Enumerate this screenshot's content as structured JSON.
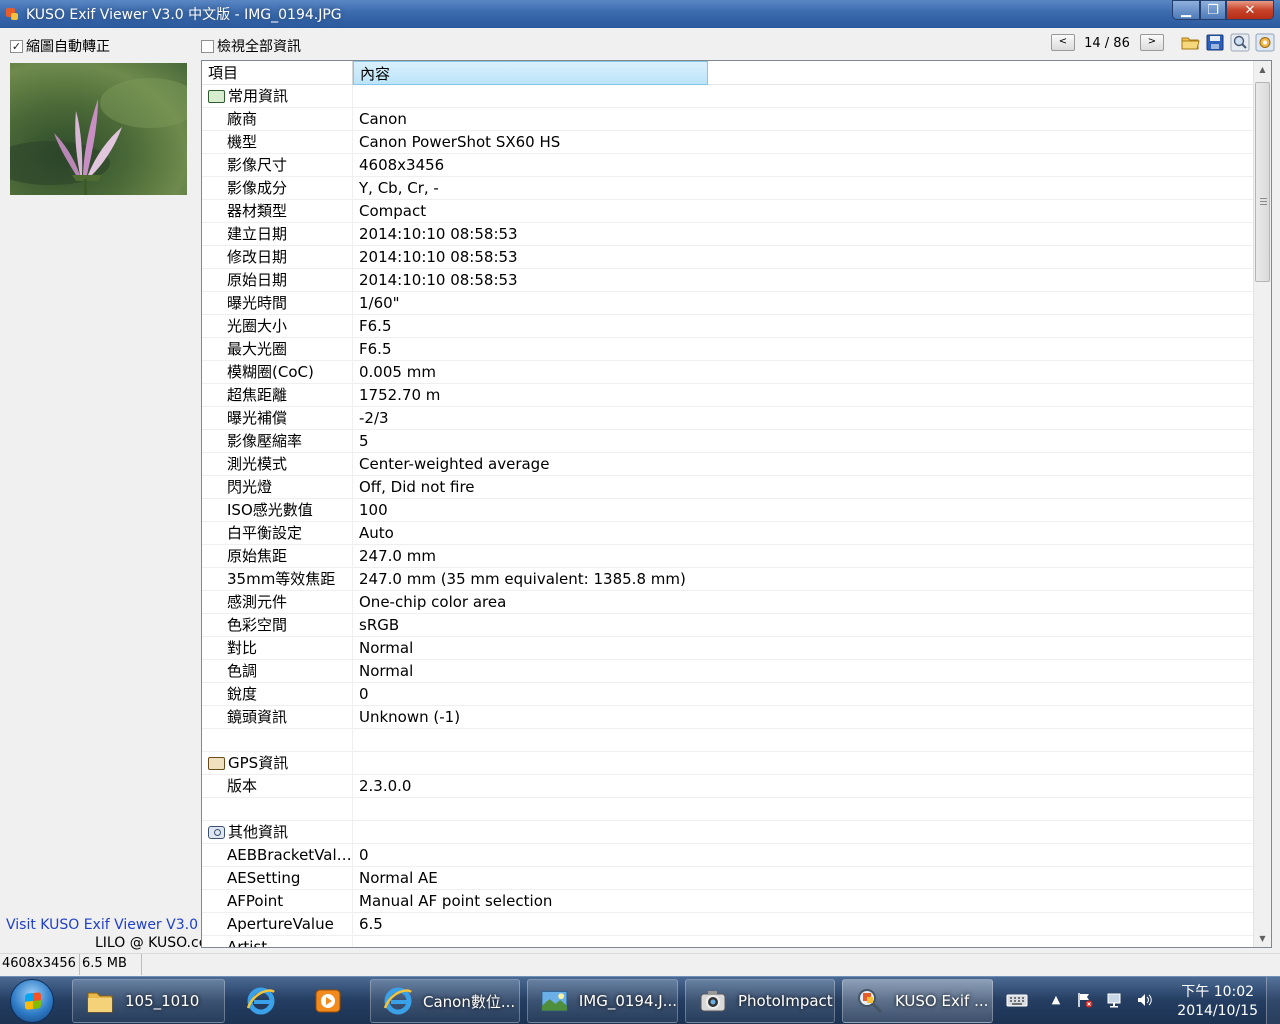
{
  "window": {
    "title": "KUSO Exif Viewer V3.0 中文版 - IMG_0194.JPG",
    "minimize_symbol": "▁",
    "maximize_symbol": "❐",
    "close_symbol": "✕"
  },
  "toolbar": {
    "auto_rotate_label": "縮圖自動轉正",
    "auto_rotate_checked": true,
    "check_mark": "✓",
    "view_all_label": "檢視全部資訊",
    "view_all_checked": false,
    "prev_label": "<",
    "next_label": ">",
    "page_info": "14 / 86",
    "icons": [
      "open-folder-icon",
      "save-icon",
      "zoom-icon",
      "settings-icon"
    ]
  },
  "left_panel": {
    "visit_link": "Visit KUSO Exif Viewer V3.0",
    "author": "LILO @ KUSO.cc"
  },
  "table": {
    "columns": [
      "項目",
      "內容"
    ],
    "rows": [
      {
        "type": "group",
        "icon": "info",
        "item": "常用資訊",
        "value": ""
      },
      {
        "type": "row",
        "item": "廠商",
        "value": "Canon"
      },
      {
        "type": "row",
        "item": "機型",
        "value": "Canon PowerShot SX60 HS"
      },
      {
        "type": "row",
        "item": "影像尺寸",
        "value": "4608x3456"
      },
      {
        "type": "row",
        "item": "影像成分",
        "value": "Y, Cb, Cr, -"
      },
      {
        "type": "row",
        "item": "器材類型",
        "value": "Compact"
      },
      {
        "type": "row",
        "item": "建立日期",
        "value": "2014:10:10 08:58:53"
      },
      {
        "type": "row",
        "item": "修改日期",
        "value": "2014:10:10 08:58:53"
      },
      {
        "type": "row",
        "item": "原始日期",
        "value": "2014:10:10 08:58:53"
      },
      {
        "type": "row",
        "item": "曝光時間",
        "value": "1/60\""
      },
      {
        "type": "row",
        "item": "光圈大小",
        "value": "F6.5"
      },
      {
        "type": "row",
        "item": "最大光圈",
        "value": "F6.5"
      },
      {
        "type": "row",
        "item": "模糊圈(CoC)",
        "value": "0.005 mm"
      },
      {
        "type": "row",
        "item": "超焦距離",
        "value": "1752.70 m"
      },
      {
        "type": "row",
        "item": "曝光補償",
        "value": "-2/3"
      },
      {
        "type": "row",
        "item": "影像壓縮率",
        "value": "5"
      },
      {
        "type": "row",
        "item": "測光模式",
        "value": "Center-weighted average"
      },
      {
        "type": "row",
        "item": "閃光燈",
        "value": "Off, Did not fire"
      },
      {
        "type": "row",
        "item": "ISO感光數值",
        "value": "100"
      },
      {
        "type": "row",
        "item": "白平衡設定",
        "value": "Auto"
      },
      {
        "type": "row",
        "item": "原始焦距",
        "value": "247.0 mm"
      },
      {
        "type": "row",
        "item": "35mm等效焦距",
        "value": "247.0 mm (35 mm equivalent: 1385.8 mm)"
      },
      {
        "type": "row",
        "item": "感測元件",
        "value": "One-chip color area"
      },
      {
        "type": "row",
        "item": "色彩空間",
        "value": "sRGB"
      },
      {
        "type": "row",
        "item": "對比",
        "value": "Normal"
      },
      {
        "type": "row",
        "item": "色調",
        "value": "Normal"
      },
      {
        "type": "row",
        "item": "銳度",
        "value": "0"
      },
      {
        "type": "row",
        "item": "鏡頭資訊",
        "value": "Unknown (-1)"
      },
      {
        "type": "blank",
        "item": "",
        "value": ""
      },
      {
        "type": "group",
        "icon": "gps",
        "item": "GPS資訊",
        "value": ""
      },
      {
        "type": "row",
        "item": "版本",
        "value": "2.3.0.0"
      },
      {
        "type": "blank",
        "item": "",
        "value": ""
      },
      {
        "type": "group",
        "icon": "cam",
        "item": "其他資訊",
        "value": ""
      },
      {
        "type": "row",
        "item": "AEBBracketValue",
        "value": "0"
      },
      {
        "type": "row",
        "item": "AESetting",
        "value": "Normal AE"
      },
      {
        "type": "row",
        "item": "AFPoint",
        "value": "Manual AF point selection"
      },
      {
        "type": "row",
        "item": "ApertureValue",
        "value": "6.5"
      },
      {
        "type": "row",
        "item": "Artist",
        "value": ""
      }
    ]
  },
  "statusbar": {
    "dimensions": "4608x3456",
    "filesize": "6.5 MB"
  },
  "taskbar": {
    "items": [
      {
        "label": "105_1010",
        "icon": "folder-icon"
      },
      {
        "label": "",
        "icon": "ie-icon"
      },
      {
        "label": "",
        "icon": "media-player-icon"
      },
      {
        "label": "Canon數位...",
        "icon": "ie-icon"
      },
      {
        "label": "IMG_0194.J...",
        "icon": "image-viewer-icon"
      },
      {
        "label": "PhotoImpact",
        "icon": "photoimpact-icon"
      },
      {
        "label": "KUSO Exif ...",
        "icon": "kuso-exif-icon"
      }
    ],
    "clock_time": "下午 10:02",
    "clock_date": "2014/10/15"
  }
}
